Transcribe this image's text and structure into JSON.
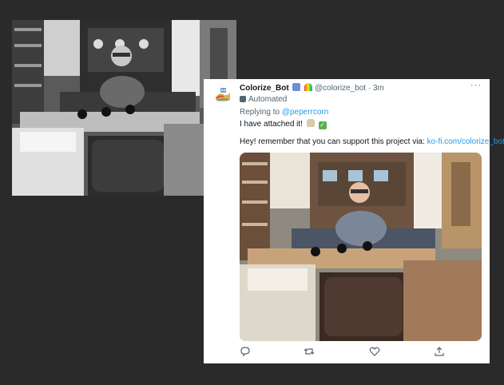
{
  "tweet": {
    "display_name": "Colorize_Bot",
    "handle": "@colorize_bot",
    "separator": "·",
    "time": "3m",
    "more": "···",
    "automated_label": "Automated",
    "reply_prefix": "Replying to",
    "reply_mention": "@peperrcorn",
    "text_line1": "I have attached it!",
    "text_line2_prefix": "Hey! remember that you can support this project via:",
    "text_line2_link": "ko-fi.com/colorize_bot"
  },
  "icons": {
    "avatar": "robot-painter-icon",
    "badge1": "building-icon",
    "badge2": "rainbow-icon",
    "automated": "robot-icon",
    "hands": "praying-hands-icon",
    "check": "check-mark-icon",
    "actions": [
      "reply-icon",
      "retweet-icon",
      "like-icon",
      "share-icon"
    ]
  },
  "colors": {
    "background": "#2a2a2a",
    "link": "#1d9bf0",
    "muted": "#536471"
  }
}
